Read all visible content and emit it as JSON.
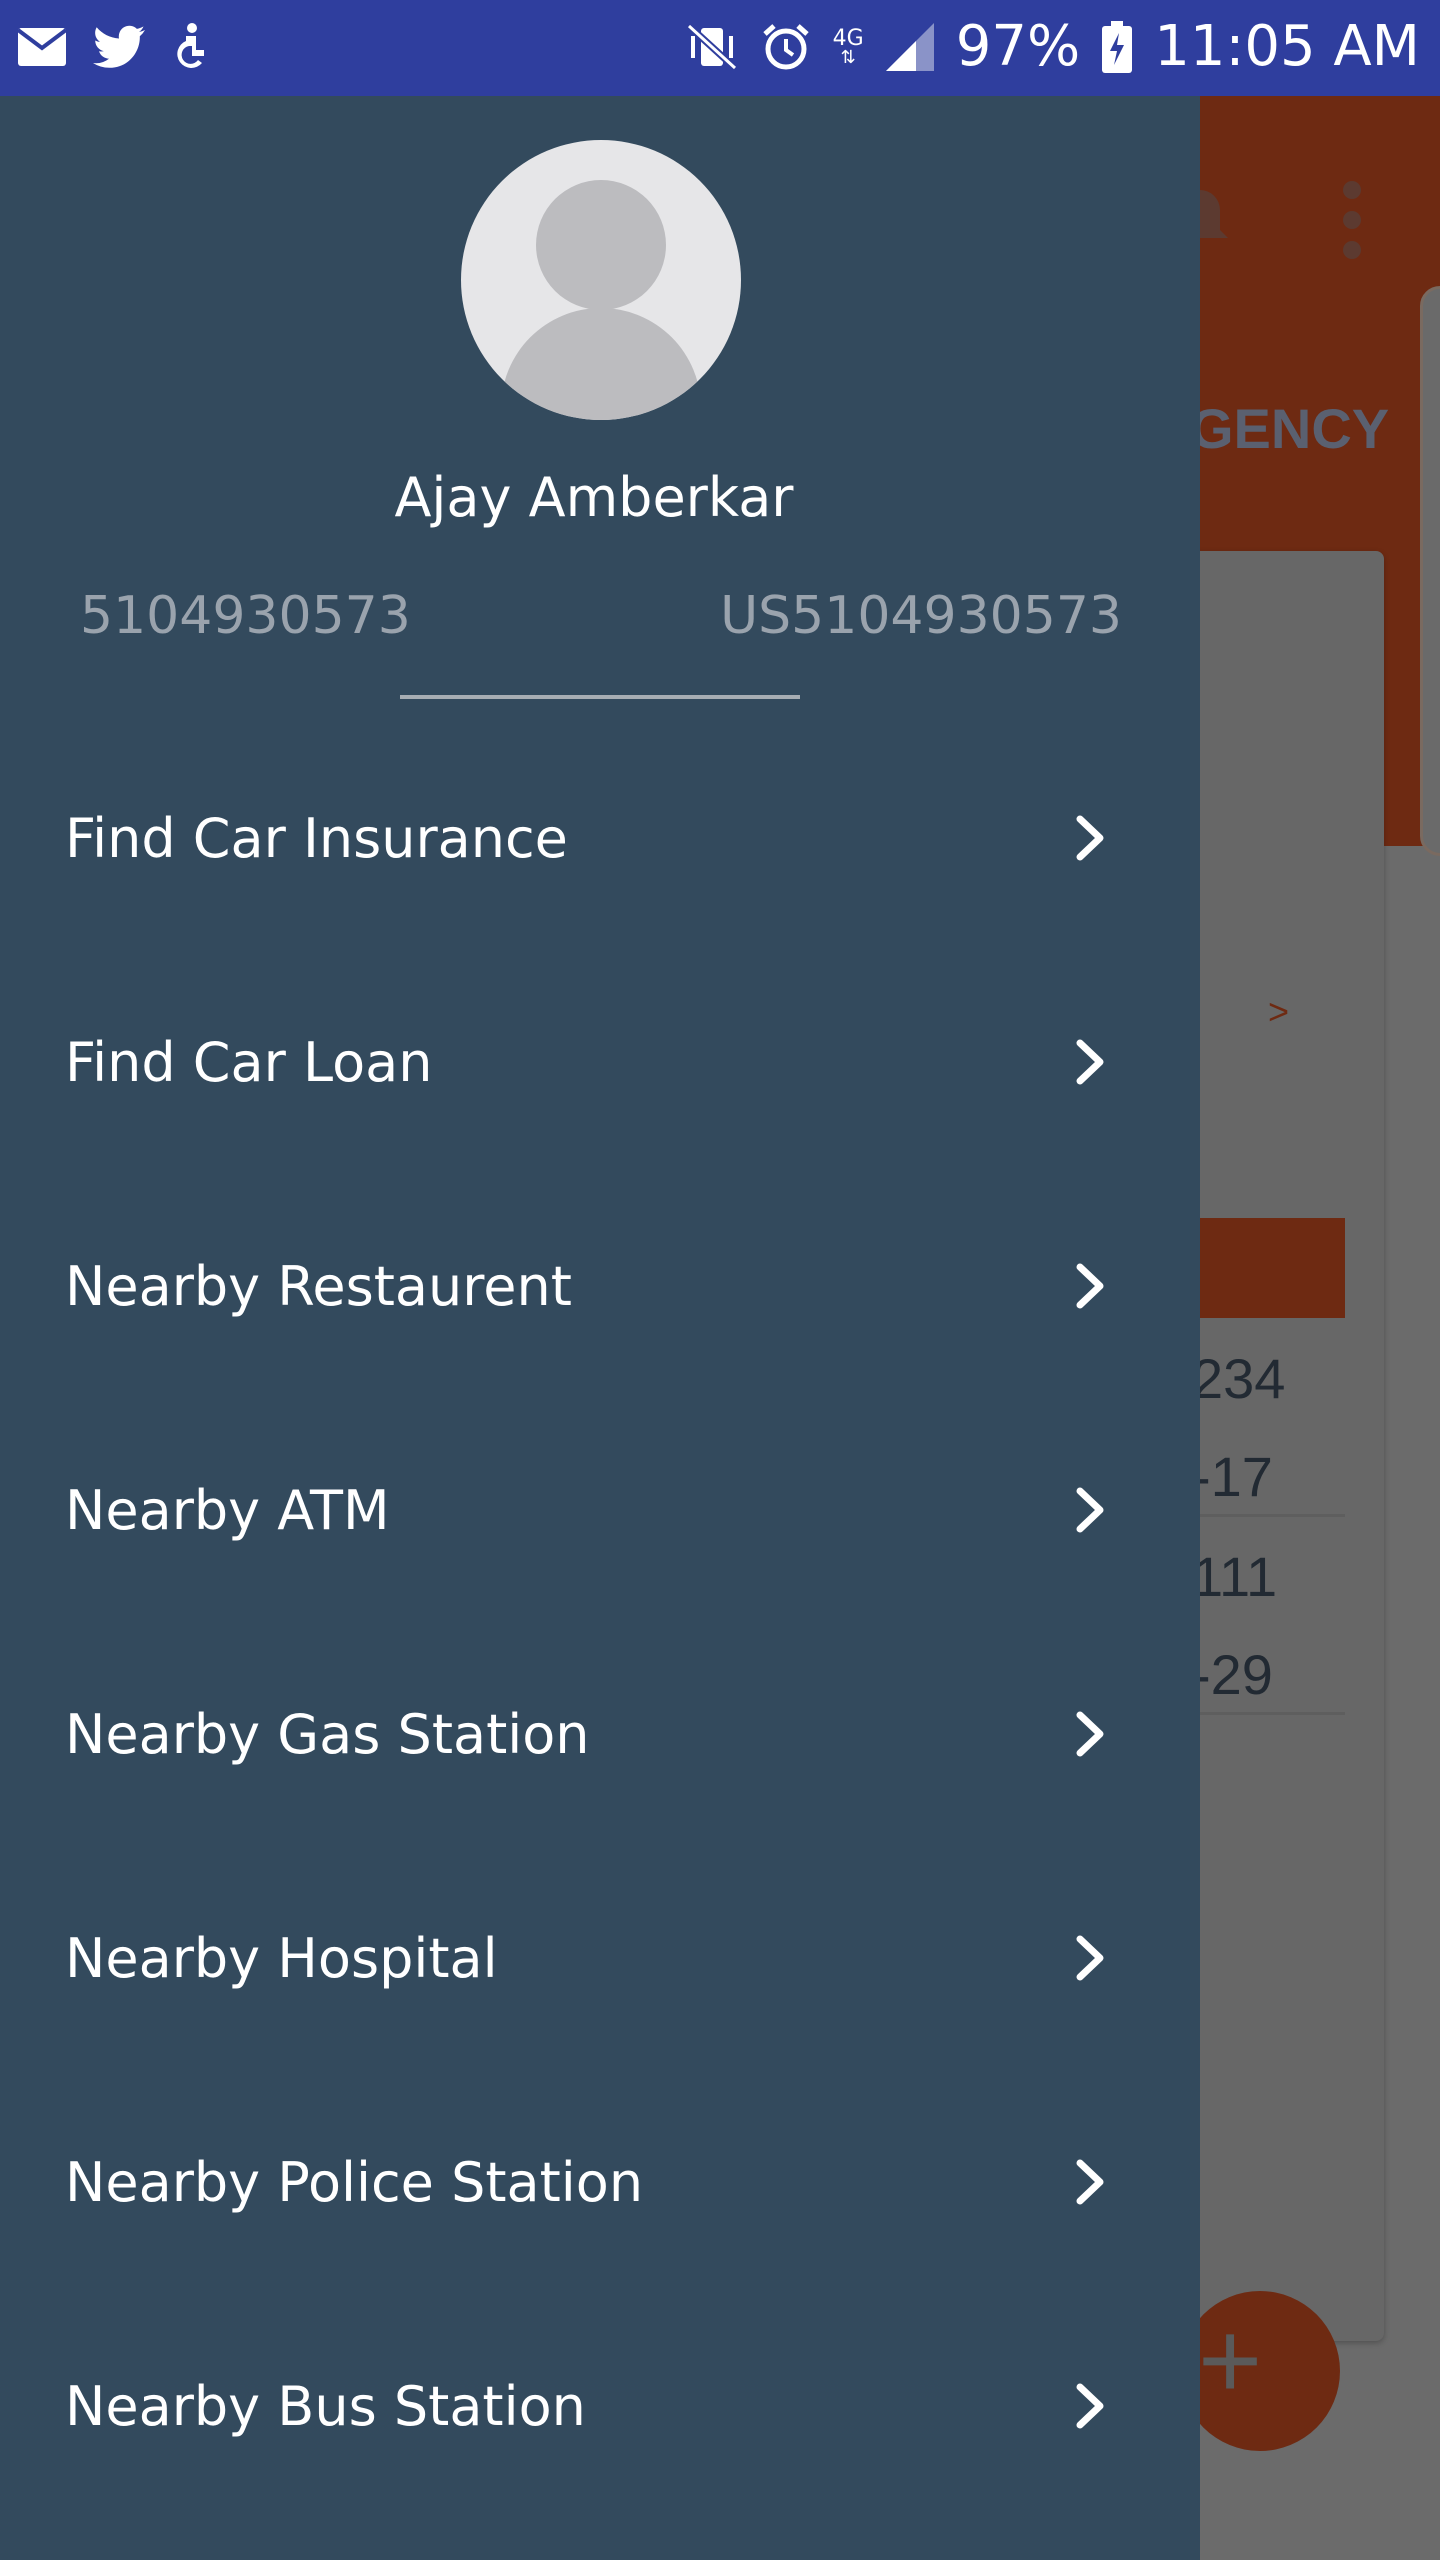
{
  "status_bar": {
    "battery": "97%",
    "time": "11:05 AM",
    "network": "4G",
    "left_icons": [
      "mail-icon",
      "twitter-icon",
      "accessibility-icon"
    ],
    "right_icons": [
      "vibrate-mute-icon",
      "alarm-icon",
      "signal-icon",
      "battery-charging-icon"
    ]
  },
  "drawer": {
    "user_name": "Ajay Amberkar",
    "account_left": "5104930573",
    "account_right": "US5104930573",
    "items": [
      {
        "label": "Find Car Insurance",
        "icon": "chevron-right-icon"
      },
      {
        "label": "Find Car Loan",
        "icon": "chevron-right-icon"
      },
      {
        "label": "Nearby Restaurent",
        "icon": "chevron-right-icon"
      },
      {
        "label": "Nearby ATM",
        "icon": "chevron-right-icon"
      },
      {
        "label": "Nearby Gas Station",
        "icon": "chevron-right-icon"
      },
      {
        "label": "Nearby Hospital",
        "icon": "chevron-right-icon"
      },
      {
        "label": "Nearby Police Station",
        "icon": "chevron-right-icon"
      },
      {
        "label": "Nearby Bus Station",
        "icon": "chevron-right-icon"
      }
    ]
  },
  "background": {
    "tab_text": "GENCY",
    "arrow": ">",
    "numbers": [
      "234",
      "-17",
      "111",
      "-29"
    ],
    "fab_icon": "plus-icon"
  },
  "colors": {
    "status_bar": "#2f3e9e",
    "drawer": "#334a5d",
    "accent": "#6e2a12",
    "scrim": "#6b6b6b"
  }
}
